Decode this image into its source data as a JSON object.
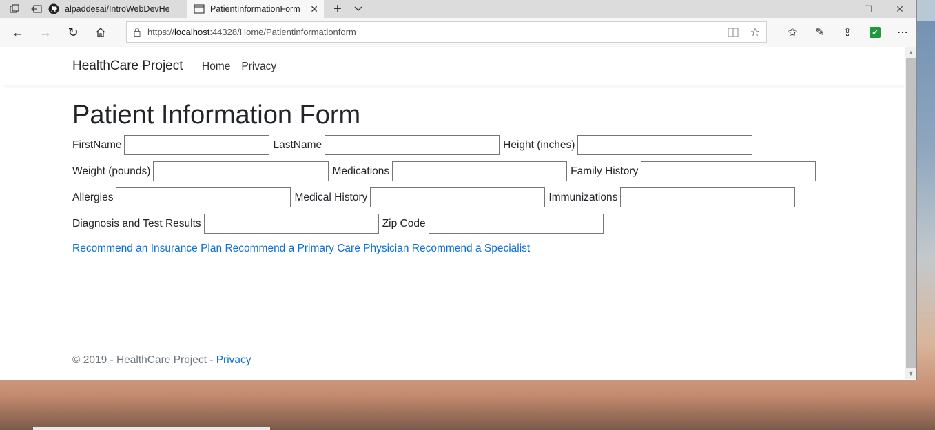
{
  "browser": {
    "tabs": [
      {
        "label": "alpaddesai/IntroWebDevHe",
        "icon": "github-icon"
      },
      {
        "label": "PatientInformationForm",
        "icon": "page-icon"
      }
    ],
    "url_scheme": "https://",
    "url_host": "localhost",
    "url_rest": ":44328/Home/Patientinformationform"
  },
  "site": {
    "brand": "HealthCare Project",
    "nav": [
      "Home",
      "Privacy"
    ]
  },
  "page": {
    "title": "Patient Information Form",
    "fields": {
      "first_name": "FirstName",
      "last_name": "LastName",
      "height": "Height (inches)",
      "weight": "Weight (pounds)",
      "medications": "Medications",
      "family_history": "Family History",
      "allergies": "Allergies",
      "medical_history": "Medical History",
      "immunizations": "Immunizations",
      "diagnosis": "Diagnosis and Test Results",
      "zip": "Zip Code"
    },
    "links": {
      "insurance": "Recommend an Insurance Plan",
      "pcp": "Recommend a Primary Care Physician",
      "specialist": "Recommend a Specialist"
    }
  },
  "footer": {
    "text": "© 2019 - HealthCare Project - ",
    "privacy": "Privacy"
  },
  "colors": {
    "link": "#0b6fd6",
    "extension": "#1f9a3a"
  }
}
